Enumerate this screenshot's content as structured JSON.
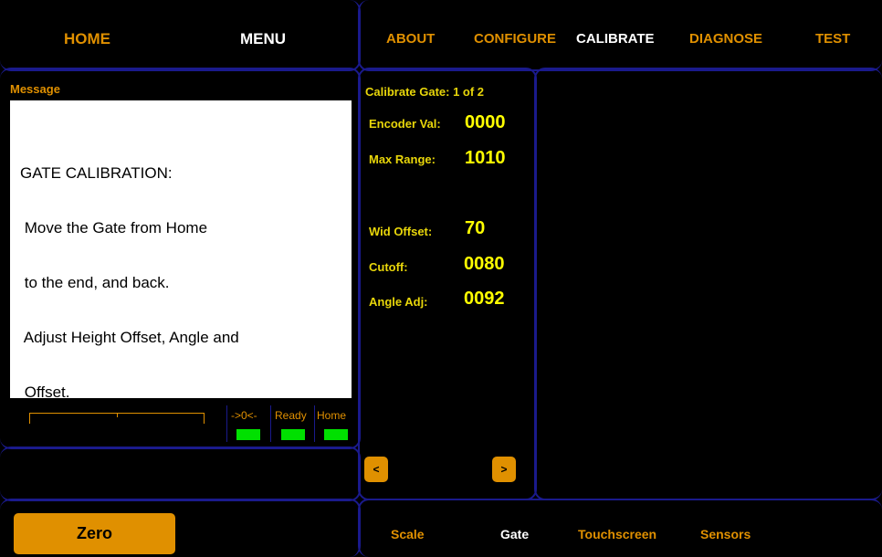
{
  "header": {
    "home": "HOME",
    "menu": "MENU"
  },
  "nav": {
    "about": "ABOUT",
    "configure": "CONFIGURE",
    "calibrate": "CALIBRATE",
    "diagnose": "DIAGNOSE",
    "test": "TEST"
  },
  "message": {
    "title": "Message",
    "lines": [
      "GATE CALIBRATION:",
      " Move the Gate from Home",
      " to the end, and back.",
      " Adjust Height Offset, Angle and",
      " Offset."
    ]
  },
  "indicators": {
    "zero": "->0<-",
    "ready": "Ready",
    "home": "Home"
  },
  "calibrate": {
    "title": "Calibrate Gate: 1 of 2",
    "encoder_label": "Encoder Val:",
    "encoder_value": "0000",
    "max_range_label": "Max Range:",
    "max_range_value": "1010",
    "wid_offset_label": "Wid Offset:",
    "wid_offset_value": "70",
    "cutoff_label": "Cutoff:",
    "cutoff_value": "0080",
    "angle_label": "Angle Adj:",
    "angle_value": "0092",
    "prev": "<",
    "next": ">"
  },
  "footer": {
    "zero_button": "Zero",
    "tabs": {
      "scale": "Scale",
      "gate": "Gate",
      "touchscreen": "Touchscreen",
      "sensors": "Sensors"
    }
  },
  "colors": {
    "accent": "#e09000",
    "value": "#ffff00",
    "border": "#1a1a8c",
    "led": "#00e000"
  }
}
